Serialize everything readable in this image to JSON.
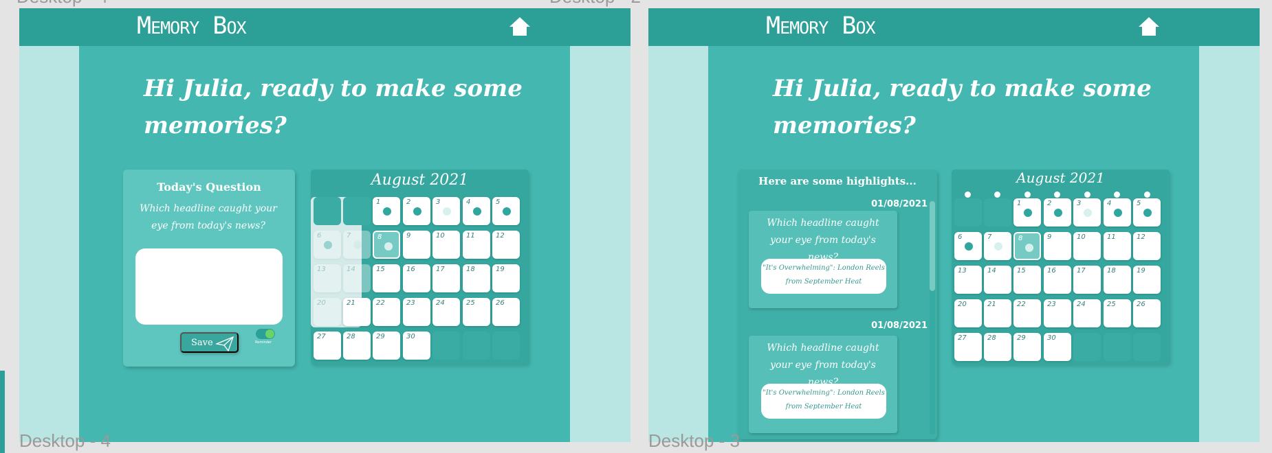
{
  "frames": {
    "desktop4": {
      "label": "Desktop - 4"
    },
    "desktop3": {
      "label": "Desktop - 3"
    }
  },
  "app": {
    "brand": "Memory Box",
    "greeting": "Hi Julia, ready to make some memories?"
  },
  "today": {
    "title": "Today's Question",
    "question": "Which headline caught your eye from today's news?",
    "answer_value": "",
    "save_label": "Save",
    "reminder_label": "Reminder"
  },
  "calendar": {
    "title": "August 2021",
    "days": [
      "1",
      "2",
      "3",
      "4",
      "5",
      "6",
      "7",
      "8",
      "9",
      "10",
      "11",
      "12",
      "13",
      "14",
      "15",
      "16",
      "17",
      "18",
      "19",
      "20",
      "21",
      "22",
      "23",
      "24",
      "25",
      "26",
      "27",
      "28",
      "29",
      "30"
    ]
  },
  "highlights": {
    "title": "Here are some highlights...",
    "items": [
      {
        "date": "01/08/2021",
        "question": "Which headline caught your eye from today's news?",
        "answer": "\"It's Overwhelming\": London Reels from September Heat"
      },
      {
        "date": "01/08/2021",
        "question": "Which headline caught your eye from today's news?",
        "answer": "\"It's Overwhelming\": London Reels from September Heat"
      }
    ]
  },
  "colors": {
    "header": "#2c9f96",
    "panel": "#44b8b0",
    "background": "#b9e6e2",
    "accent_toggle": "#6ad26a"
  }
}
